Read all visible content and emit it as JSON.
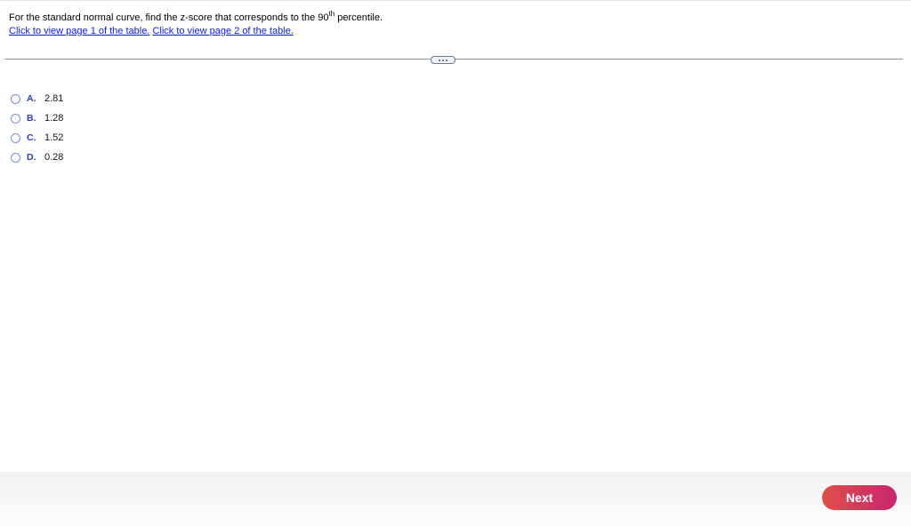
{
  "question": {
    "text_before": "For the standard normal curve, find the z-score that corresponds to the 90",
    "superscript": "th",
    "text_after": " percentile."
  },
  "links": [
    {
      "label": "Click to view page 1 of the table."
    },
    {
      "label": "Click to view page 2 of the table."
    }
  ],
  "more_button": {
    "icon": "ellipsis-icon"
  },
  "options": [
    {
      "letter": "A.",
      "value": "2.81"
    },
    {
      "letter": "B.",
      "value": "1.28"
    },
    {
      "letter": "C.",
      "value": "1.52"
    },
    {
      "letter": "D.",
      "value": "0.28"
    }
  ],
  "footer": {
    "next_label": "Next"
  },
  "colors": {
    "link": "#0a1fd4",
    "option_letter": "#2a3fb0",
    "next_gradient_start": "#de4f48",
    "next_gradient_end": "#c8256e"
  }
}
